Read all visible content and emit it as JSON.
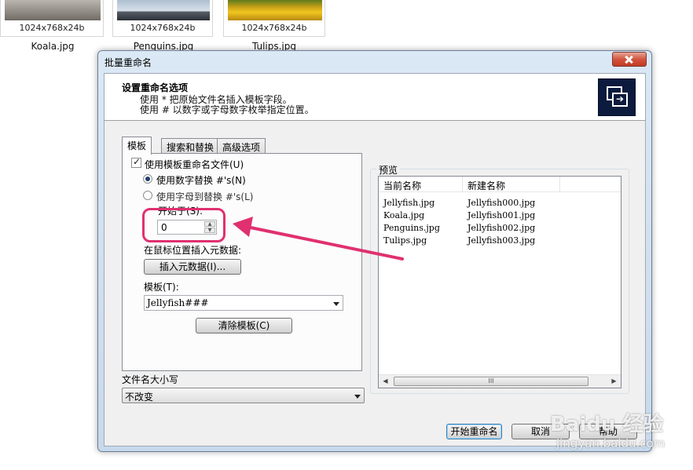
{
  "thumbnails": [
    {
      "resolution": "1024x768x24b",
      "filename": "Koala.jpg"
    },
    {
      "resolution": "1024x768x24b",
      "filename": "Penguins.jpg"
    },
    {
      "resolution": "1024x768x24b",
      "filename": "Tulips.jpg"
    }
  ],
  "dialog": {
    "title": "批量重命名",
    "header": {
      "title": "设置重命名选项",
      "line1": "使用 * 把原始文件名插入模板字段。",
      "line2": "使用 # 以数字或字母数字枚举指定位置。"
    },
    "tabs": [
      "模板",
      "搜索和替换",
      "高级选项"
    ],
    "template_tab": {
      "use_template_label": "使用模板重命名文件(U)",
      "use_template_checked": true,
      "radio_numeric_label": "使用数字替换 #'s(N)",
      "radio_alpha_label": "使用字母到替换 #'s(L)",
      "selected_radio": "numeric",
      "start_at_label": "开始于(S):",
      "start_at_value": "0",
      "insert_metadata_label": "在鼠标位置插入元数据:",
      "insert_metadata_button": "插入元数据(I)...",
      "template_label": "模板(T):",
      "template_value": "Jellyfish###",
      "clear_template_button": "清除模板(C)"
    },
    "filename_case": {
      "label": "文件名大小写",
      "value": "不改变"
    },
    "preview": {
      "label": "预览",
      "columns": [
        "当前名称",
        "新建名称"
      ],
      "rows": [
        [
          "Jellyfish.jpg",
          "Jellyfish000.jpg"
        ],
        [
          "Koala.jpg",
          "Jellyfish001.jpg"
        ],
        [
          "Penguins.jpg",
          "Jellyfish002.jpg"
        ],
        [
          "Tulips.jpg",
          "Jellyfish003.jpg"
        ]
      ],
      "scroll_thumb_grip": "III"
    },
    "buttons": {
      "start_rename": "开始重命名",
      "cancel": "取消",
      "help": "帮助"
    }
  },
  "watermark": {
    "brand": "Baidu 经验",
    "url": "jingyan.baidu.com"
  },
  "colors": {
    "annotation": "#e0306f",
    "dialog_frame": "#c8d9ec"
  }
}
